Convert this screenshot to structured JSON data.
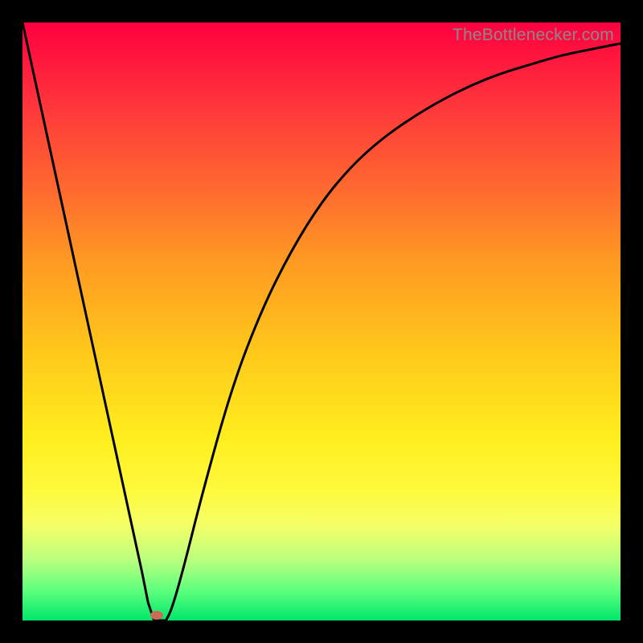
{
  "attribution": "TheBottlenecker.com",
  "marker": {
    "x_frac": 0.225,
    "y_frac": 0.992
  },
  "chart_data": {
    "type": "line",
    "title": "",
    "xlabel": "",
    "ylabel": "",
    "xlim": [
      0,
      1
    ],
    "ylim": [
      0,
      1
    ],
    "series": [
      {
        "name": "bottleneck-curve",
        "x": [
          0.0,
          0.05,
          0.1,
          0.15,
          0.2,
          0.21,
          0.22,
          0.24,
          0.25,
          0.27,
          0.3,
          0.35,
          0.4,
          0.45,
          0.5,
          0.55,
          0.6,
          0.65,
          0.7,
          0.75,
          0.8,
          0.85,
          0.9,
          0.95,
          1.0
        ],
        "y": [
          1.0,
          0.77,
          0.54,
          0.31,
          0.08,
          0.03,
          0.0,
          0.0,
          0.02,
          0.09,
          0.21,
          0.39,
          0.52,
          0.62,
          0.7,
          0.76,
          0.805,
          0.84,
          0.87,
          0.895,
          0.915,
          0.93,
          0.945,
          0.955,
          0.965
        ]
      }
    ],
    "marker_point": {
      "x": 0.225,
      "y": 0.0
    },
    "background_gradient": {
      "top": "#ff0040",
      "bottom": "#00e66a",
      "stops": [
        "#ff0040",
        "#ff3a3a",
        "#ff6a2f",
        "#ff9a22",
        "#ffc81a",
        "#ffef1f",
        "#fff93c",
        "#f5ff66",
        "#b8ff7e",
        "#5eff7e",
        "#00e66a"
      ]
    }
  }
}
